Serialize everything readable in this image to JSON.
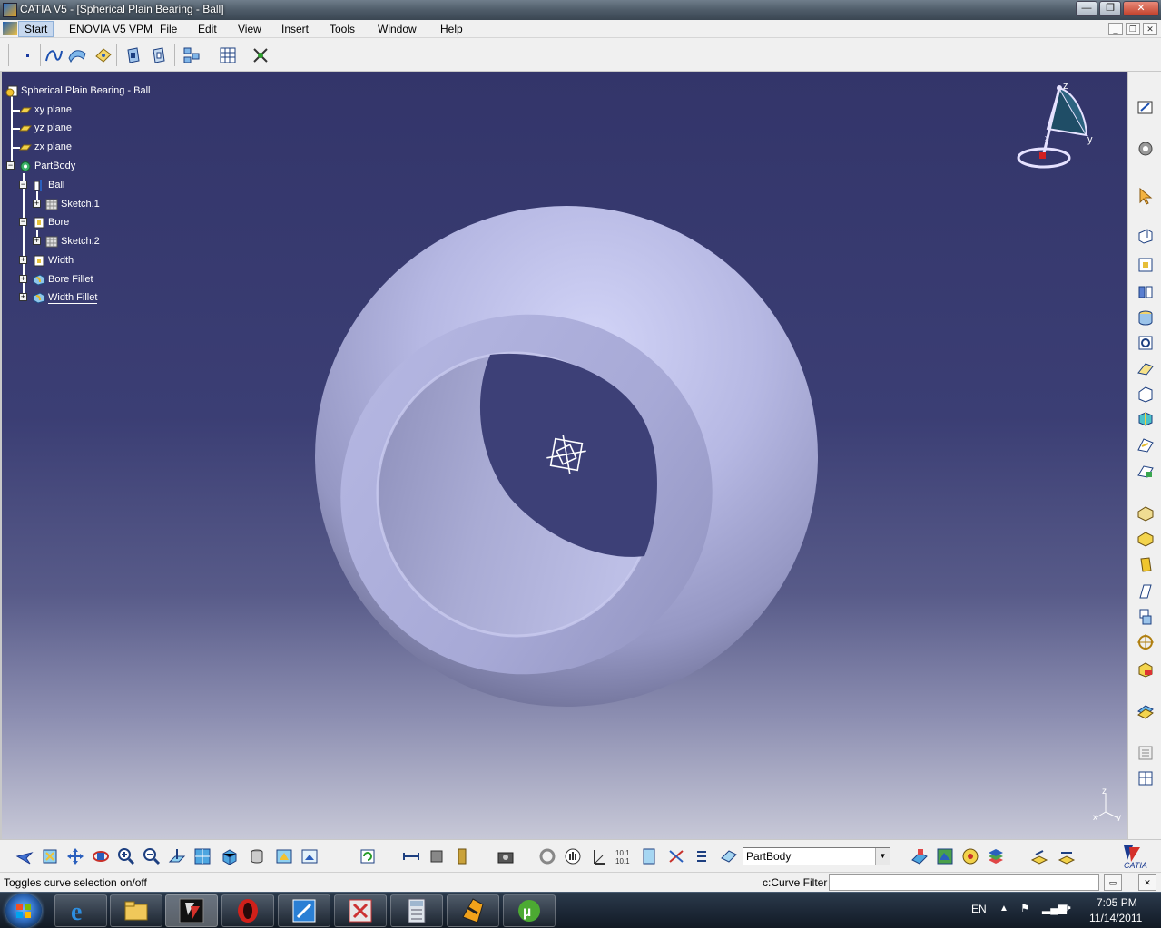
{
  "window": {
    "title": "CATIA V5 - [Spherical Plain Bearing - Ball]",
    "buttons": {
      "minimize": "—",
      "restore": "❐",
      "close": "✕"
    }
  },
  "menu": {
    "items": [
      "Start",
      "ENOVIA V5 VPM",
      "File",
      "Edit",
      "View",
      "Insert",
      "Tools",
      "Window",
      "Help"
    ]
  },
  "tree": {
    "root": "Spherical Plain Bearing - Ball",
    "planes": [
      "xy plane",
      "yz plane",
      "zx plane"
    ],
    "body": "PartBody",
    "features": [
      "Ball",
      "Sketch.1",
      "Bore",
      "Sketch.2",
      "Width",
      "Bore Fillet",
      "Width Fillet"
    ]
  },
  "compass": {
    "z": "z",
    "y": "y",
    "x": "x"
  },
  "axis_triad": {
    "z": "z",
    "x": "x",
    "y": "y"
  },
  "bottom_toolbar": {
    "body_select": "PartBody",
    "logo": "CATIA"
  },
  "status": {
    "message": "Toggles curve selection on/off",
    "filter_label": "c:Curve Filter",
    "command_value": ""
  },
  "taskbar": {
    "apps": [
      "internet-explorer",
      "file-explorer",
      "catia",
      "opera",
      "app-5",
      "app-6",
      "calculator",
      "winamp",
      "utorrent"
    ],
    "language": "EN",
    "time": "7:05 PM",
    "date": "11/14/2011"
  },
  "colors": {
    "viewport_top": "#33356a",
    "viewport_bottom": "#c7c8d7",
    "part_surface": "#b3b5e0",
    "tree_text": "#ffffff"
  }
}
